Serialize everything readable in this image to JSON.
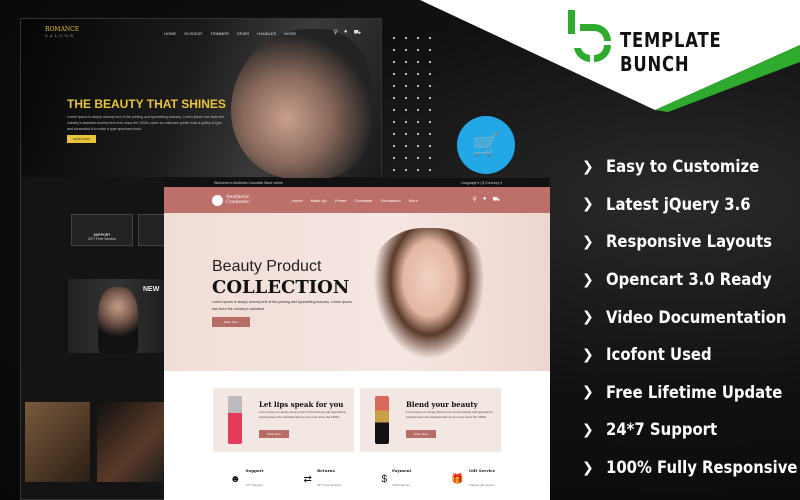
{
  "brand": {
    "name": "TEMPLATE BUNCH",
    "accent": "#2eaa2e"
  },
  "features": [
    "Easy to Customize",
    "Latest jQuery 3.6",
    "Responsive Layouts",
    "Opencart 3.0 Ready",
    "Video Documentation",
    "Icofont Used",
    "Free Lifetime Update",
    "24*7 Support",
    "100% Fully Responsive"
  ],
  "dark_theme": {
    "logo": "ROMANCE",
    "logo_sub": "SALOON",
    "menu": [
      "HOME",
      "SCISSOR",
      "TRIMMER",
      "DRIER",
      "HANDLES",
      "MORE"
    ],
    "hero_title": "THE BEAUTY THAT SHINES",
    "hero_text": "Lorem Ipsum is simply dummy text of the printing and typesetting industry. Lorem Ipsum has been the industry's standard dummy text ever since the 1500s, when an unknown printer took a galley of type and scrambled it to make a type specimen book.",
    "hero_button": "SHOP NOW",
    "support_title": "SUPPORT",
    "support_sub": "24*7 Free Service",
    "new_heading": "NEW",
    "categories_heading": "CA",
    "accent": "#e7c53a"
  },
  "light_theme": {
    "topbar_welcome": "Welcome to Aesthetic Cosmetic Store online",
    "topbar_right": "Language ▾  |  $ Currency ▾",
    "logo": "Aesthetic Cosmetic",
    "menu": [
      "Home",
      "Make Up",
      "Primer",
      "Concealer",
      "Foundation",
      "More"
    ],
    "hero_line1": "Beauty Product",
    "hero_line2": "COLLECTION",
    "hero_text": "Lorem Ipsum is simply dummy text of the printing and typesetting industry. Lorem Ipsum has been the industry's standard.",
    "hero_button": "Shop Now",
    "cards": [
      {
        "title": "Let lips speak for you",
        "text": "Lorem Ipsum is simply dummy text of the printing and typesetting industry.been the standard dummy text ever since the 1500s.",
        "button": "Shop Now"
      },
      {
        "title": "Blend your beauty",
        "text": "Lorem Ipsum is simply dummy text of the printing and typesetting industry.been the standard dummy text ever since the 1500s.",
        "button": "Shop Now"
      }
    ],
    "services": [
      {
        "icon": "support-icon",
        "title": "Support",
        "sub": "24*7 Support"
      },
      {
        "icon": "returns-icon",
        "title": "Returns",
        "sub": "24*7 Free Returns"
      },
      {
        "icon": "payment-icon",
        "title": "Payment",
        "sub": "100% Secure"
      },
      {
        "icon": "gift-icon",
        "title": "Gift Service",
        "sub": "Support gift service"
      }
    ],
    "accent": "#bd6f6a"
  }
}
